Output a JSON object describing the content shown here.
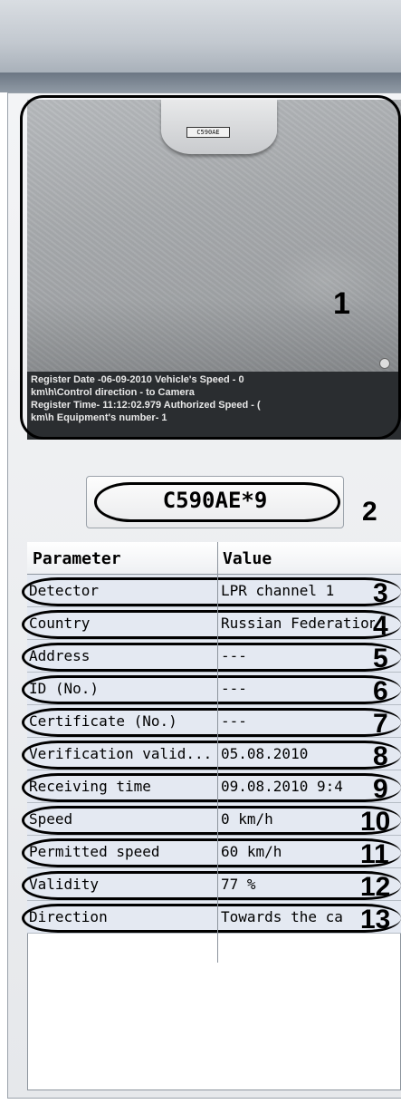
{
  "photo": {
    "plate_on_car": "C590AE",
    "overlay_lines": [
      "Register Date -06-09-2010    Vehicle's Speed - 0",
      "km\\h\\Control direction - to Camera",
      "Register Time- 11:12:02.979  Authorized Speed - (",
      "km\\h    Equipment's number- 1"
    ]
  },
  "recognized_plate": "C590AE*9",
  "table": {
    "header_param": "Parameter",
    "header_value": "Value",
    "rows": [
      {
        "param": "Detector",
        "value": "LPR channel 1"
      },
      {
        "param": "Country",
        "value": "Russian Federation"
      },
      {
        "param": "Address",
        "value": "---"
      },
      {
        "param": "ID (No.)",
        "value": "---"
      },
      {
        "param": "Certificate (No.)",
        "value": "---"
      },
      {
        "param": "Verification valid...",
        "value": "05.08.2010"
      },
      {
        "param": "Receiving time",
        "value": "09.08.2010 9:4"
      },
      {
        "param": "Speed",
        "value": "0 km/h"
      },
      {
        "param": "Permitted speed",
        "value": "60 km/h"
      },
      {
        "param": "Validity",
        "value": "77 %"
      },
      {
        "param": "Direction",
        "value": "Towards the ca"
      }
    ]
  },
  "callout_numbers": [
    "1",
    "2",
    "3",
    "4",
    "5",
    "6",
    "7",
    "8",
    "9",
    "10",
    "11",
    "12",
    "13"
  ]
}
